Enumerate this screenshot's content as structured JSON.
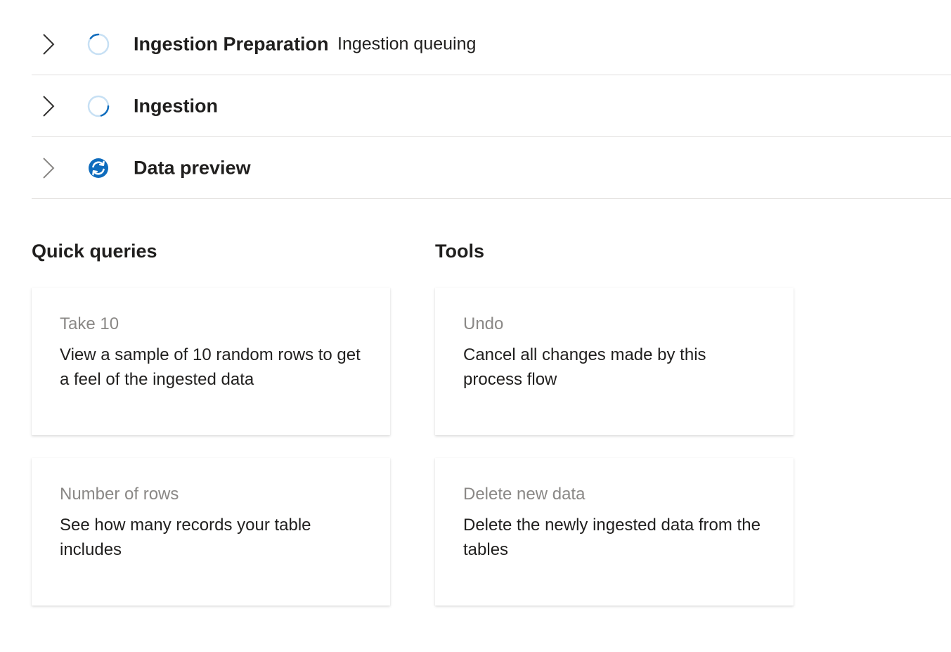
{
  "steps": [
    {
      "title": "Ingestion Preparation",
      "subtitle": "Ingestion queuing",
      "status_icon": "loading-spinner-icon"
    },
    {
      "title": "Ingestion",
      "subtitle": "",
      "status_icon": "loading-spinner-icon"
    },
    {
      "title": "Data preview",
      "subtitle": "",
      "status_icon": "sync-icon"
    }
  ],
  "quick_queries": {
    "heading": "Quick queries",
    "cards": [
      {
        "title": "Take 10",
        "description": "View a sample of 10 random rows to get a feel of the ingested data"
      },
      {
        "title": "Number of rows",
        "description": "See how many records your table includes"
      }
    ]
  },
  "tools": {
    "heading": "Tools",
    "cards": [
      {
        "title": "Undo",
        "description": "Cancel all changes made by this process flow"
      },
      {
        "title": "Delete new data",
        "description": "Delete the newly ingested data from the tables"
      }
    ]
  },
  "colors": {
    "accent": "#0f6cbd",
    "spinner_track": "#c7e0f4",
    "muted_text": "#8a8886",
    "divider": "#e1dfdd"
  }
}
